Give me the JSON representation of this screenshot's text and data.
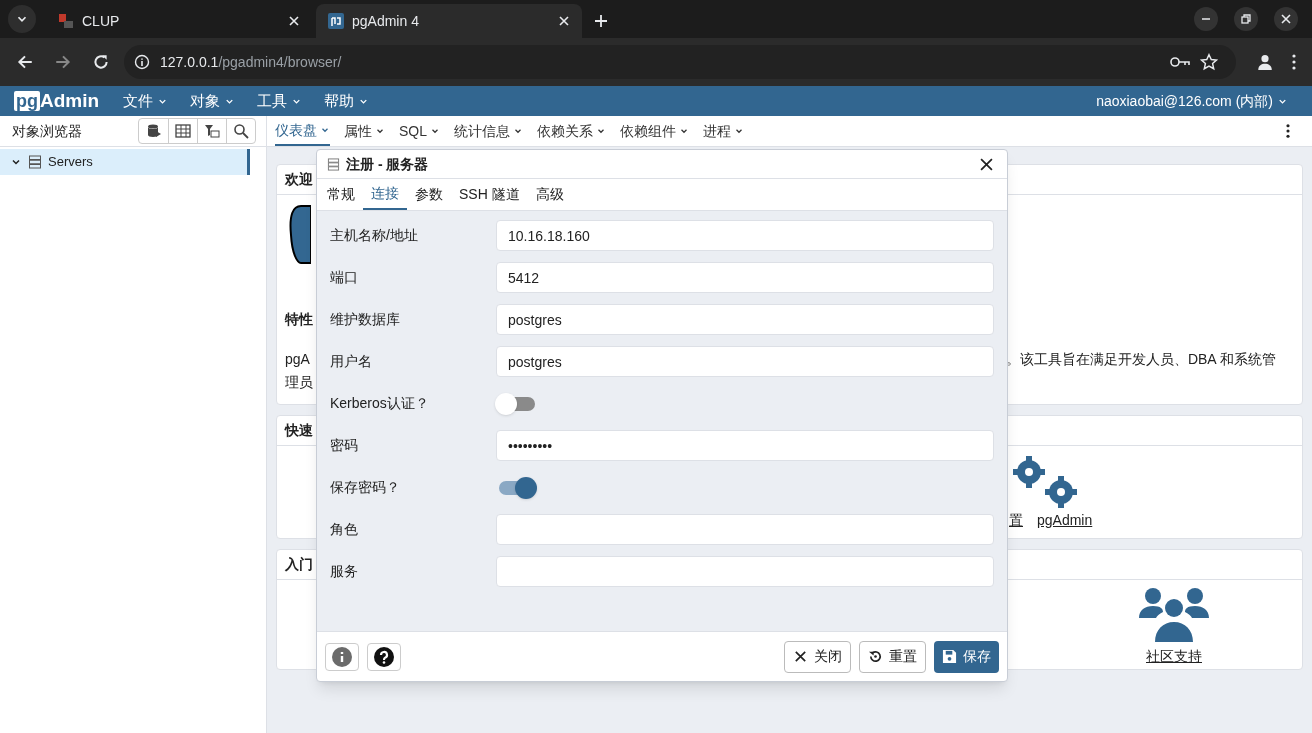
{
  "browser": {
    "tabs": [
      {
        "title": "CLUP",
        "kind": "clup",
        "selected": false
      },
      {
        "title": "pgAdmin 4",
        "kind": "pg",
        "selected": true
      }
    ],
    "url_host": "127.0.0.1",
    "url_path": "/pgadmin4/browser/"
  },
  "menu_bar": {
    "logo_box": "pg",
    "logo_text": "Admin",
    "menus": [
      "文件",
      "对象",
      "工具",
      "帮助"
    ],
    "user": "naoxiaobai@126.com (内部)"
  },
  "sidebar": {
    "title": "对象浏览器",
    "tree": [
      {
        "label": "Servers",
        "expanded": true,
        "selected": true
      }
    ]
  },
  "main_tabs": [
    {
      "label": "仪表盘",
      "selected": true
    },
    {
      "label": "属性",
      "selected": false
    },
    {
      "label": "SQL",
      "selected": false
    },
    {
      "label": "统计信息",
      "selected": false
    },
    {
      "label": "依赖关系",
      "selected": false
    },
    {
      "label": "依赖组件",
      "selected": false
    },
    {
      "label": "进程",
      "selected": false
    }
  ],
  "dashboard": {
    "welcome_title": "欢迎",
    "features_title": "特性",
    "description_left": [
      "pgA",
      "理员"
    ],
    "description_right": "。该工具旨在满足开发人员、DBA 和系统管",
    "quick_title": "快速",
    "quick_links": [
      "置",
      "pgAdmin"
    ],
    "start_title": "入门",
    "community_link": "社区支持"
  },
  "dialog": {
    "title": "注册 - 服务器",
    "tabs": [
      {
        "label": "常规",
        "selected": false
      },
      {
        "label": "连接",
        "selected": true
      },
      {
        "label": "参数",
        "selected": false
      },
      {
        "label": "SSH 隧道",
        "selected": false
      },
      {
        "label": "高级",
        "selected": false
      }
    ],
    "fields": [
      {
        "kind": "text",
        "label": "主机名称/地址",
        "value": "10.16.18.160"
      },
      {
        "kind": "text",
        "label": "端口",
        "value": "5412"
      },
      {
        "kind": "text",
        "label": "维护数据库",
        "value": "postgres"
      },
      {
        "kind": "text",
        "label": "用户名",
        "value": "postgres"
      },
      {
        "kind": "switch",
        "label": "Kerberos认证？",
        "on": false
      },
      {
        "kind": "text",
        "label": "密码",
        "value": "•••••••••"
      },
      {
        "kind": "switch",
        "label": "保存密码？",
        "on": true
      },
      {
        "kind": "text",
        "label": "角色"
      },
      {
        "kind": "text",
        "label": "服务"
      }
    ],
    "buttons": [
      {
        "kind": "close",
        "label": "关闭"
      },
      {
        "kind": "reset",
        "label": "重置"
      },
      {
        "kind": "save",
        "label": "保存"
      }
    ]
  }
}
